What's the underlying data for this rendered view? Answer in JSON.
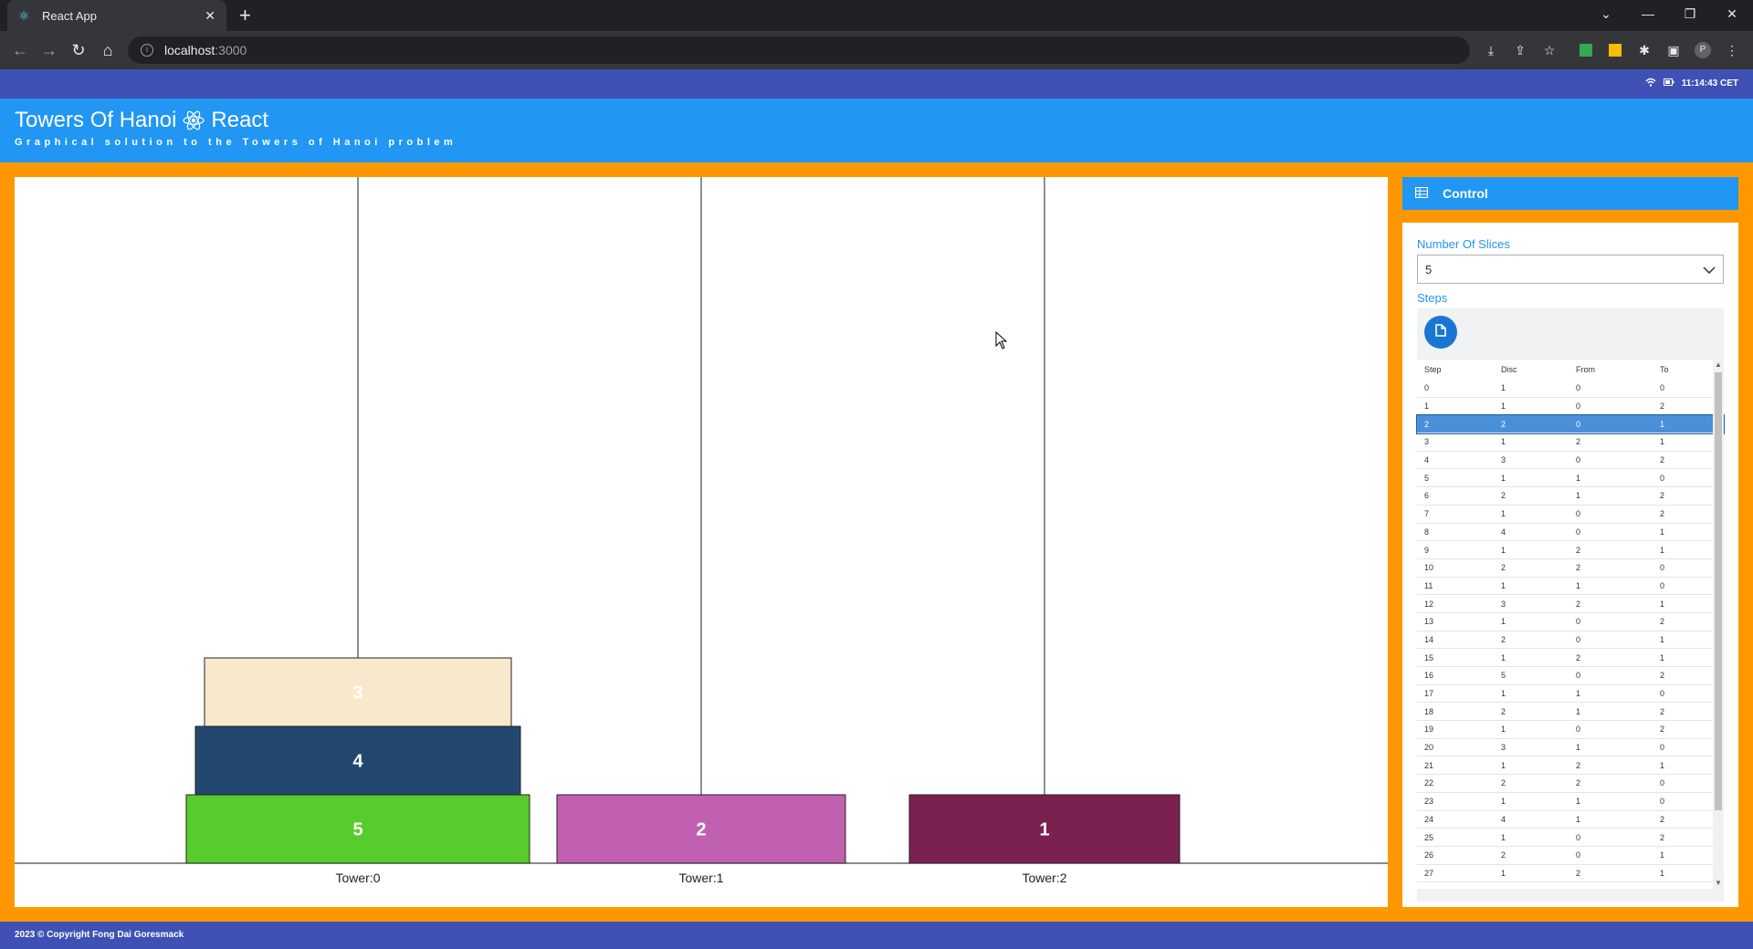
{
  "browser": {
    "tab_title": "React App",
    "url_host": "localhost",
    "url_port": ":3000"
  },
  "status": {
    "time": "11:14:43 CET"
  },
  "app": {
    "title": "Towers Of Hanoi",
    "title_suffix": "React",
    "subtitle": "Graphical solution to the Towers of Hanoi problem"
  },
  "board": {
    "towers": [
      {
        "label": "Tower:0",
        "discs": [
          5,
          4,
          3
        ]
      },
      {
        "label": "Tower:1",
        "discs": [
          2
        ]
      },
      {
        "label": "Tower:2",
        "discs": [
          1
        ]
      }
    ],
    "disc_colors": {
      "1": "#7b2150",
      "2": "#c160b0",
      "3": "#f8e8cc",
      "4": "#224870",
      "5": "#58cc2c"
    }
  },
  "control": {
    "title": "Control",
    "slices_label": "Number Of Slices",
    "slices_value": "5",
    "steps_label": "Steps",
    "columns": [
      "Step",
      "Disc",
      "From",
      "To"
    ],
    "selected_step": 2,
    "rows": [
      [
        "0",
        "1",
        "0",
        "0"
      ],
      [
        "1",
        "1",
        "0",
        "2"
      ],
      [
        "2",
        "2",
        "0",
        "1"
      ],
      [
        "3",
        "1",
        "2",
        "1"
      ],
      [
        "4",
        "3",
        "0",
        "2"
      ],
      [
        "5",
        "1",
        "1",
        "0"
      ],
      [
        "6",
        "2",
        "1",
        "2"
      ],
      [
        "7",
        "1",
        "0",
        "2"
      ],
      [
        "8",
        "4",
        "0",
        "1"
      ],
      [
        "9",
        "1",
        "2",
        "1"
      ],
      [
        "10",
        "2",
        "2",
        "0"
      ],
      [
        "11",
        "1",
        "1",
        "0"
      ],
      [
        "12",
        "3",
        "2",
        "1"
      ],
      [
        "13",
        "1",
        "0",
        "2"
      ],
      [
        "14",
        "2",
        "0",
        "1"
      ],
      [
        "15",
        "1",
        "2",
        "1"
      ],
      [
        "16",
        "5",
        "0",
        "2"
      ],
      [
        "17",
        "1",
        "1",
        "0"
      ],
      [
        "18",
        "2",
        "1",
        "2"
      ],
      [
        "19",
        "1",
        "0",
        "2"
      ],
      [
        "20",
        "3",
        "1",
        "0"
      ],
      [
        "21",
        "1",
        "2",
        "1"
      ],
      [
        "22",
        "2",
        "2",
        "0"
      ],
      [
        "23",
        "1",
        "1",
        "0"
      ],
      [
        "24",
        "4",
        "1",
        "2"
      ],
      [
        "25",
        "1",
        "0",
        "2"
      ],
      [
        "26",
        "2",
        "0",
        "1"
      ],
      [
        "27",
        "1",
        "2",
        "1"
      ]
    ]
  },
  "footer": {
    "text": "2023 © Copyright Fong Dai Goresmack"
  },
  "colors": {
    "accent": "#2196f3",
    "topbar": "#3f51b5",
    "background": "#ff9800"
  }
}
